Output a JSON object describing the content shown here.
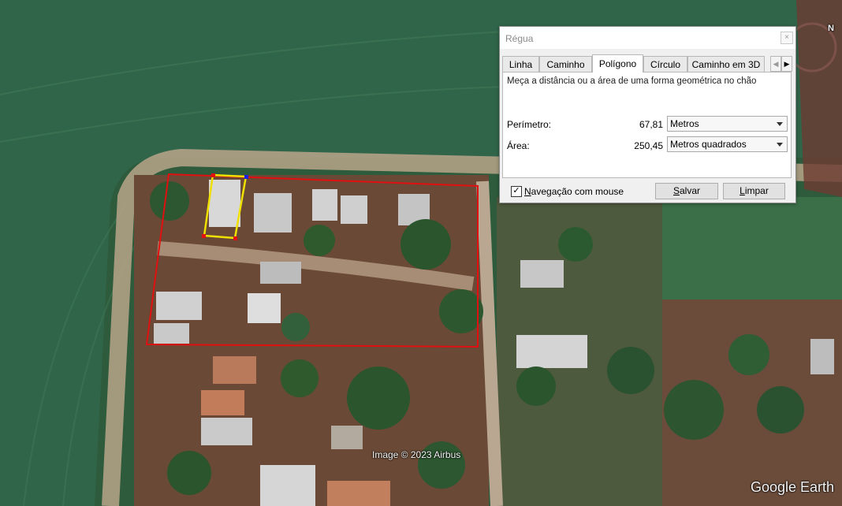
{
  "map": {
    "attribution": "Image © 2023 Airbus",
    "logo": "Google Earth",
    "compass_letter": "N",
    "measure_color": "#e01010",
    "segment_color": "#f0e000"
  },
  "dialog": {
    "title": "Régua",
    "close_label": "×",
    "tabs": [
      {
        "label": "Linha"
      },
      {
        "label": "Caminho"
      },
      {
        "label": "Polígono",
        "active": true
      },
      {
        "label": "Círculo"
      },
      {
        "label": "Caminho em 3D"
      }
    ],
    "description": "Meça a distância ou a área de uma forma geométrica no chão",
    "perimeter": {
      "label": "Perímetro:",
      "value": "67,81",
      "unit": "Metros"
    },
    "area": {
      "label": "Área:",
      "value": "250,45",
      "unit": "Metros quadrados"
    },
    "mouse_nav": {
      "label": "Navegação com mouse",
      "checked": true
    },
    "save_label": "Salvar",
    "clear_label": "Limpar"
  }
}
